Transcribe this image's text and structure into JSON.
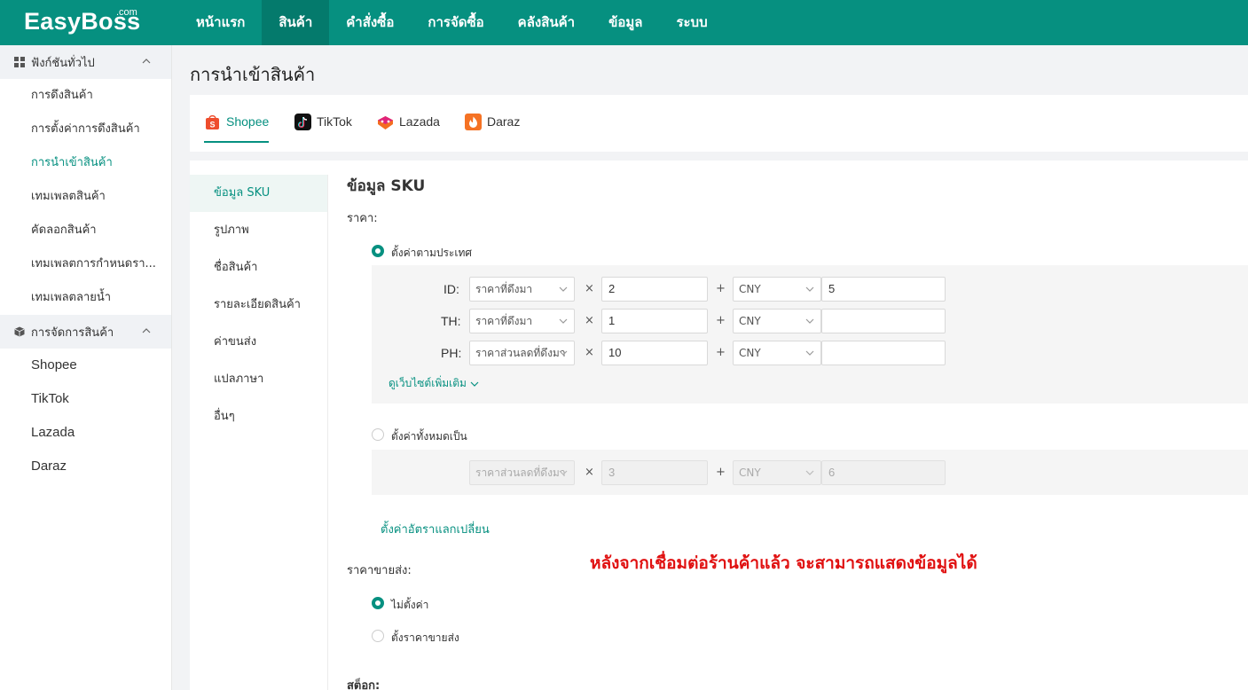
{
  "brand": {
    "logo": "EasyBoss",
    "logo_sup": ".com"
  },
  "topnav": [
    {
      "label": "หน้าแรก",
      "active": false
    },
    {
      "label": "สินค้า",
      "active": true
    },
    {
      "label": "คำสั่งซื้อ",
      "active": false
    },
    {
      "label": "การจัดซื้อ",
      "active": false
    },
    {
      "label": "คลังสินค้า",
      "active": false
    },
    {
      "label": "ข้อมูล",
      "active": false
    },
    {
      "label": "ระบบ",
      "active": false
    }
  ],
  "sidebar": {
    "group1": {
      "label": "ฟังก์ชันทั่วไป",
      "icon": "grid-icon"
    },
    "group1_items": [
      {
        "label": "การดึงสินค้า"
      },
      {
        "label": "การตั้งค่าการดึงสินค้า"
      },
      {
        "label": "การนำเข้าสินค้า",
        "active": true
      },
      {
        "label": "เทมเพลตสินค้า"
      },
      {
        "label": "คัดลอกสินค้า"
      },
      {
        "label": "เทมเพลตการกำหนดรา..."
      },
      {
        "label": "เทมเพลตลายน้ำ"
      }
    ],
    "group2": {
      "label": "การจัดการสินค้า",
      "icon": "box-icon"
    },
    "group2_items": [
      {
        "label": "Shopee"
      },
      {
        "label": "TikTok"
      },
      {
        "label": "Lazada"
      },
      {
        "label": "Daraz"
      }
    ]
  },
  "page": {
    "title": "การนำเข้าสินค้า"
  },
  "platform_tabs": [
    {
      "label": "Shopee",
      "icon": "shopee-icon",
      "active": true
    },
    {
      "label": "TikTok",
      "icon": "tiktok-icon"
    },
    {
      "label": "Lazada",
      "icon": "lazada-icon"
    },
    {
      "label": "Daraz",
      "icon": "daraz-icon"
    }
  ],
  "left_menu": [
    {
      "label": "ข้อมูล SKU",
      "active": true
    },
    {
      "label": "รูปภาพ"
    },
    {
      "label": "ชื่อสินค้า"
    },
    {
      "label": "รายละเอียดสินค้า"
    },
    {
      "label": "ค่าขนส่ง"
    },
    {
      "label": "แปลภาษา"
    },
    {
      "label": "อื่นๆ"
    }
  ],
  "sku": {
    "title": "ข้อมูล SKU",
    "price_label": "ราคา:",
    "opt_by_country": "ตั้งค่าตามประเทศ",
    "rows": [
      {
        "country": "ID:",
        "price_type": "ราคาที่ดึงมา",
        "multiplier": "2",
        "currency": "CNY",
        "add": "5"
      },
      {
        "country": "TH:",
        "price_type": "ราคาที่ดึงมา",
        "multiplier": "1",
        "currency": "CNY",
        "add": ""
      },
      {
        "country": "PH:",
        "price_type": "ราคาส่วนลดที่ดึงมา",
        "multiplier": "10",
        "currency": "CNY",
        "add": ""
      }
    ],
    "times_sign": "×",
    "plus_sign": "+",
    "more_sites": "ดูเว็บไซต์เพิ่มเติม",
    "opt_all": "ตั้งค่าทั้งหมดเป็น",
    "all_row": {
      "price_type": "ราคาส่วนลดที่ดึงมา",
      "multiplier": "3",
      "currency": "CNY",
      "add": "6"
    },
    "exchange_link": "ตั้งค่าอัตราแลกเปลี่ยน",
    "wholesale_label": "ราคาขายส่ง:",
    "wholesale_opt1": "ไม่ตั้งค่า",
    "wholesale_opt2": "ตั้งราคาขายส่ง",
    "stock_label": "สต็อก:"
  },
  "notice": "หลังจากเชื่อมต่อร้านค้าแล้ว  จะสามารถแสดงข้อมูลได้",
  "colors": {
    "primary": "#069080",
    "primary_dark": "#047a6c",
    "notice": "#e01010"
  }
}
